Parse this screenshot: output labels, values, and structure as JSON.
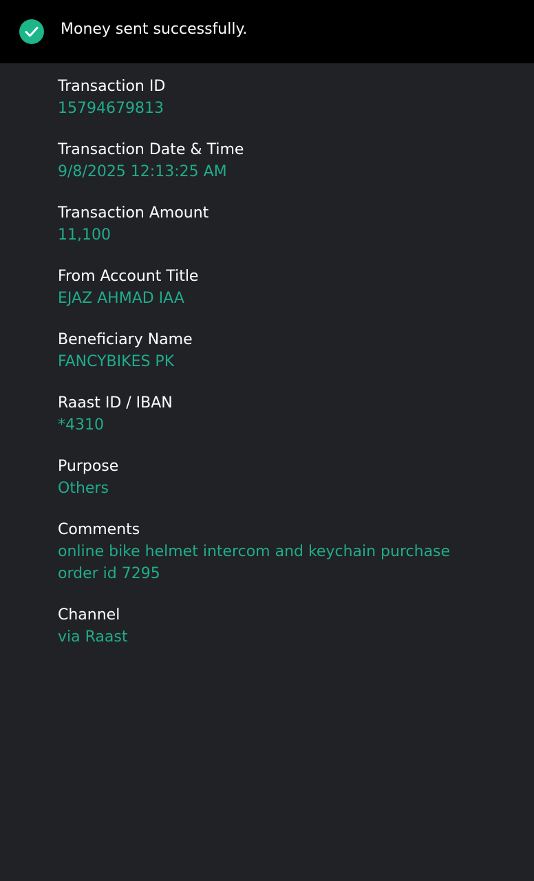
{
  "banner": {
    "icon": "check-circle-icon",
    "message": "Money sent successfully.",
    "accent_color": "#1db58a"
  },
  "fields": [
    {
      "label": "Transaction ID",
      "value": "15794679813"
    },
    {
      "label": "Transaction Date & Time",
      "value": "9/8/2025 12:13:25 AM"
    },
    {
      "label": "Transaction Amount",
      "value": "11,100"
    },
    {
      "label": "From Account Title",
      "value": "EJAZ AHMAD IAA"
    },
    {
      "label": "Beneficiary Name",
      "value": "FANCYBIKES PK"
    },
    {
      "label": "Raast ID / IBAN",
      "value": "*4310"
    },
    {
      "label": "Purpose",
      "value": "Others"
    },
    {
      "label": "Comments",
      "value": "online bike helmet intercom and keychain purchase order id 7295"
    },
    {
      "label": "Channel",
      "value": "via Raast"
    }
  ],
  "colors": {
    "background": "#212226",
    "banner_background": "#000000",
    "label": "#ffffff",
    "value": "#1fac8b"
  }
}
